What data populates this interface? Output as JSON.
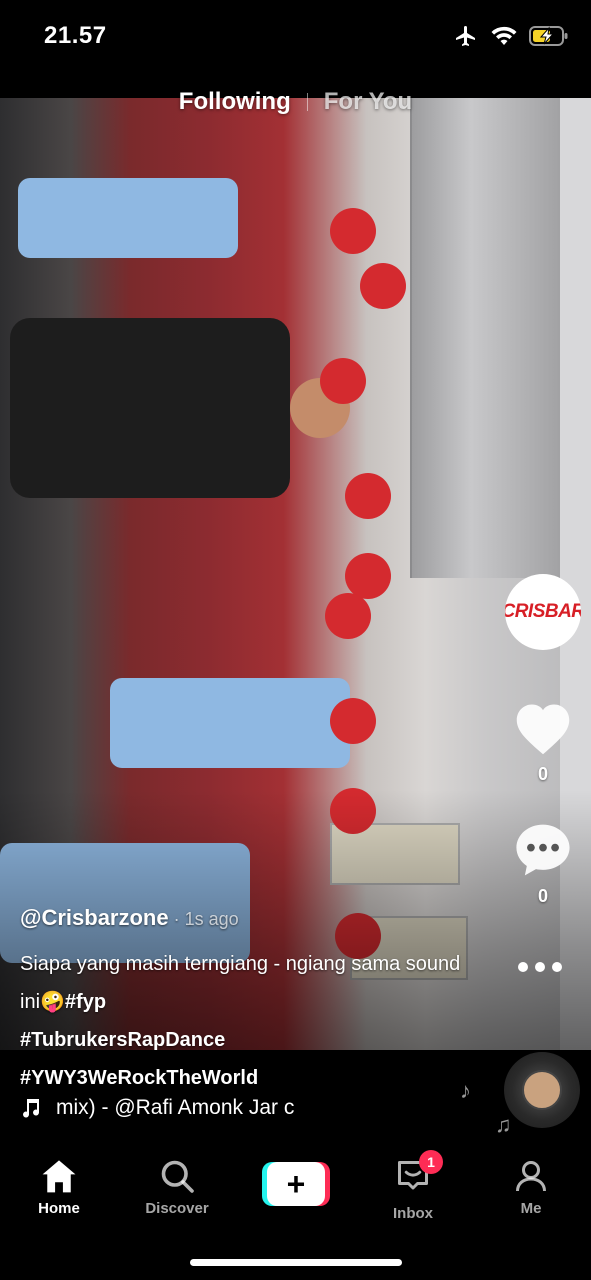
{
  "status_bar": {
    "time": "21.57",
    "icons": [
      "airplane-icon",
      "wifi-icon",
      "battery-charging-icon"
    ],
    "battery_color": "#f5d327"
  },
  "top_tabs": {
    "following": "Following",
    "for_you": "For You",
    "active": "Following"
  },
  "video": {
    "profile_logo_text": "CRISBAR",
    "likes": "0",
    "comments": "0"
  },
  "caption": {
    "username": "@Crisbarzone",
    "time_ago": " · 1s ago",
    "text": "Siapa yang masih terngiang - ngiang sama sound ini",
    "emoji": "🤪",
    "tags": [
      "#fyp",
      "#TubrukersRapDance",
      "#YWY3WeRockTheWorld"
    ]
  },
  "music": {
    "text": "mix) - @Rafi Amonk    Jar c"
  },
  "bottom_nav": {
    "home": "Home",
    "discover": "Discover",
    "inbox": "Inbox",
    "inbox_badge": "1",
    "me": "Me",
    "create_symbol": "+"
  },
  "colors": {
    "accent_red": "#fe2c55",
    "accent_cyan": "#25f4ee"
  }
}
